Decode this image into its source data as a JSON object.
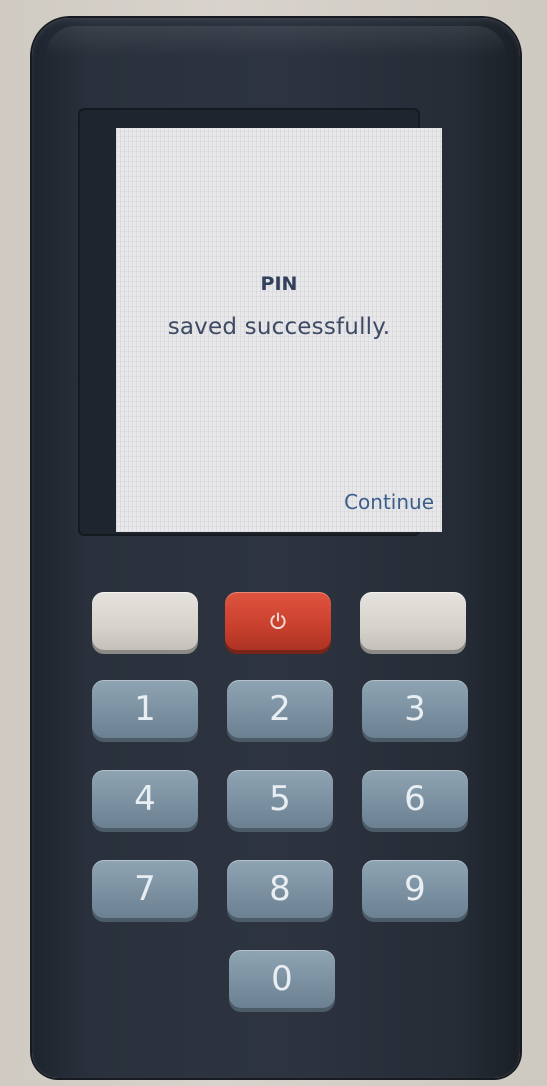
{
  "screen": {
    "title": "PIN",
    "message": "saved successfully.",
    "continue_label": "Continue"
  },
  "softkeys": {
    "left_label": "",
    "right_label": ""
  },
  "power": {
    "icon": "power-icon"
  },
  "keypad": {
    "k1": "1",
    "k2": "2",
    "k3": "3",
    "k4": "4",
    "k5": "5",
    "k6": "6",
    "k7": "7",
    "k8": "8",
    "k9": "9",
    "k0": "0"
  },
  "colors": {
    "screen_text": "#3d4a63",
    "continue_text": "#3b5f8a",
    "power_key": "#c8402d",
    "number_key": "#7b91a1",
    "soft_key": "#d6d2cc",
    "device_body": "#2d3440"
  }
}
